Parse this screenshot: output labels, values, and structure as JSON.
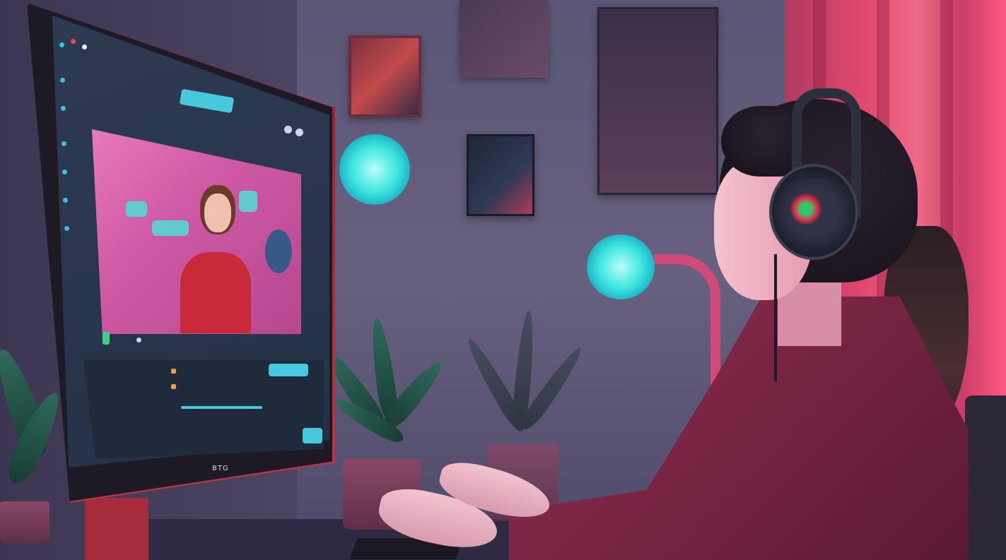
{
  "scene": {
    "description_colors": {
      "wall": "#5c5677",
      "curtain": "#e0476e",
      "accent_cyan": "#46c8dd",
      "monitor_frame": "#c23545",
      "jacket": "#7a2444"
    }
  },
  "monitor": {
    "brand": "BTG"
  },
  "icons": {
    "headset": "headset-icon",
    "lamp": "lamp-icon"
  }
}
